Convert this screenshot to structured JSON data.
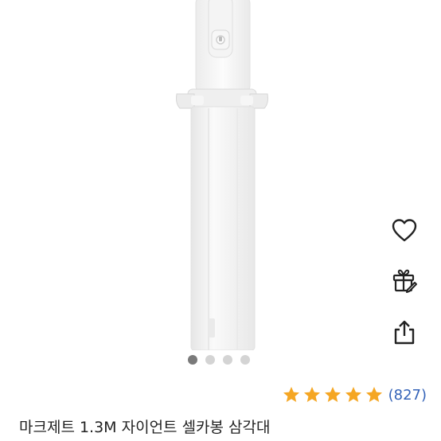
{
  "product": {
    "title": "마크제트 1.3M 자이언트 셀카봉 삼각대",
    "rating": 5,
    "rating_max": 5,
    "review_count": "(827)"
  },
  "gallery": {
    "image_count": 4,
    "active_index": 0
  },
  "actions": [
    {
      "name": "wishlist",
      "icon": "heart-icon"
    },
    {
      "name": "gift",
      "icon": "gift-icon"
    },
    {
      "name": "share",
      "icon": "share-icon"
    }
  ],
  "colors": {
    "star": "#F5A623",
    "review_link": "#3463B8",
    "dot_active": "#7A7A7A",
    "dot_inactive": "#D4D4D4",
    "product_body": "#F2F2F2"
  }
}
